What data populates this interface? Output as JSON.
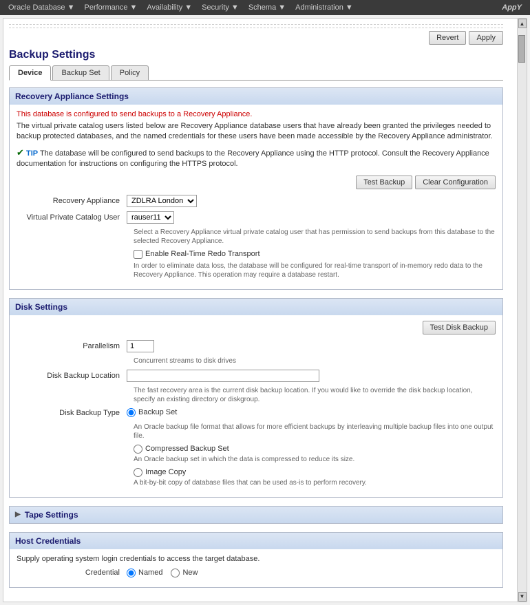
{
  "topbar": {
    "menus": [
      {
        "label": "Oracle Database",
        "hasArrow": true
      },
      {
        "label": "Performance",
        "hasArrow": true
      },
      {
        "label": "Availability",
        "hasArrow": true
      },
      {
        "label": "Security",
        "hasArrow": true
      },
      {
        "label": "Schema",
        "hasArrow": true
      },
      {
        "label": "Administration",
        "hasArrow": true
      }
    ],
    "app_name": "AppY"
  },
  "toolbar": {
    "revert_label": "Revert",
    "apply_label": "Apply"
  },
  "page": {
    "title": "Backup Settings"
  },
  "tabs": [
    {
      "label": "Device",
      "active": true
    },
    {
      "label": "Backup Set",
      "active": false
    },
    {
      "label": "Policy",
      "active": false
    }
  ],
  "recovery_section": {
    "title": "Recovery Appliance Settings",
    "info_text": "This database is configured to send backups to a Recovery Appliance.",
    "body_text": "The virtual private catalog users listed below are Recovery Appliance database users that have already been granted the privileges needed to backup protected databases, and the named credentials for these users have been made accessible by the Recovery Appliance administrator.",
    "tip_text": "TIP The database will be configured to send backups to the Recovery Appliance using the HTTP protocol. Consult the Recovery Appliance documentation for instructions on configuring the HTTPS protocol.",
    "test_backup_label": "Test Backup",
    "clear_config_label": "Clear Configuration",
    "recovery_appliance_label": "Recovery Appliance",
    "recovery_appliance_value": "ZDLRA London",
    "vp_catalog_label": "Virtual Private Catalog User",
    "vp_catalog_value": "rauser11",
    "catalog_hint": "Select a Recovery Appliance virtual private catalog user that has permission to send backups from this database to the selected Recovery Appliance.",
    "enable_redo_label": "Enable Real-Time Redo Transport",
    "redo_hint": "In order to eliminate data loss, the database will be configured for real-time transport of in-memory redo data to the Recovery Appliance. This operation may require a database restart."
  },
  "disk_section": {
    "title": "Disk Settings",
    "test_disk_label": "Test Disk Backup",
    "parallelism_label": "Parallelism",
    "parallelism_value": "1",
    "parallelism_hint": "Concurrent streams to disk drives",
    "location_label": "Disk Backup Location",
    "location_value": "",
    "location_hint": "The fast recovery area is the current disk backup location. If you would like to override the disk backup location, specify an existing directory or diskgroup.",
    "type_label": "Disk Backup Type",
    "backup_set_label": "Backup Set",
    "backup_set_desc": "An Oracle backup file format that allows for more efficient backups by interleaving multiple backup files into one output file.",
    "compressed_label": "Compressed Backup Set",
    "compressed_desc": "An Oracle backup set in which the data is compressed to reduce its size.",
    "image_copy_label": "Image Copy",
    "image_copy_desc": "A bit-by-bit copy of database files that can be used as-is to perform recovery."
  },
  "tape_section": {
    "title": "Tape Settings",
    "collapsed": true
  },
  "host_section": {
    "title": "Host Credentials",
    "info_text": "Supply operating system login credentials to access the target database.",
    "credential_label": "Credential",
    "named_label": "Named",
    "new_label": "New"
  }
}
